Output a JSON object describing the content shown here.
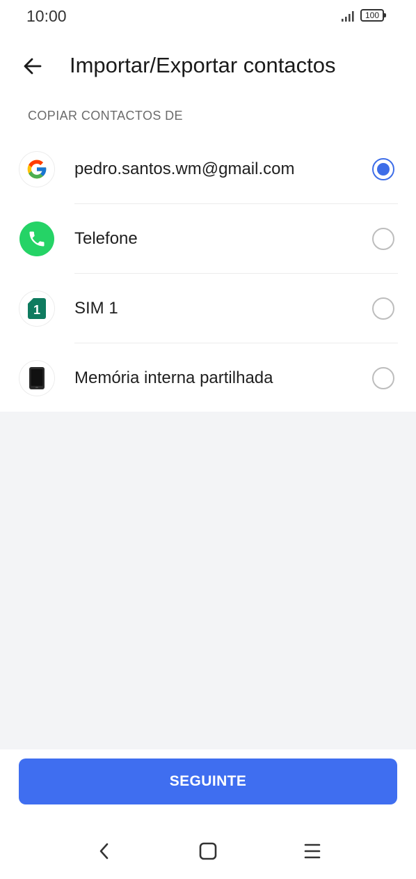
{
  "status_bar": {
    "time": "10:00",
    "battery": "100"
  },
  "header": {
    "title": "Importar/Exportar contactos",
    "back_icon": "arrow-left-icon"
  },
  "section": {
    "title": "COPIAR CONTACTOS DE"
  },
  "options": [
    {
      "label": "pedro.santos.wm@gmail.com",
      "icon": "google-icon",
      "selected": true
    },
    {
      "label": "Telefone",
      "icon": "phone-icon",
      "selected": false
    },
    {
      "label": "SIM 1",
      "icon": "sim-card-icon",
      "sim_number": "1",
      "selected": false
    },
    {
      "label": "Memória interna partilhada",
      "icon": "device-storage-icon",
      "selected": false
    }
  ],
  "footer": {
    "next_label": "SEGUINTE"
  },
  "colors": {
    "accent": "#3f6ef0",
    "radio_selected": "#3d6de8",
    "phone_green": "#25d366",
    "sim_green": "#0f7b5f",
    "background_empty": "#f3f4f6"
  },
  "nav_bar": {
    "back_icon": "nav-back-icon",
    "home_icon": "nav-home-icon",
    "menu_icon": "nav-menu-icon"
  }
}
